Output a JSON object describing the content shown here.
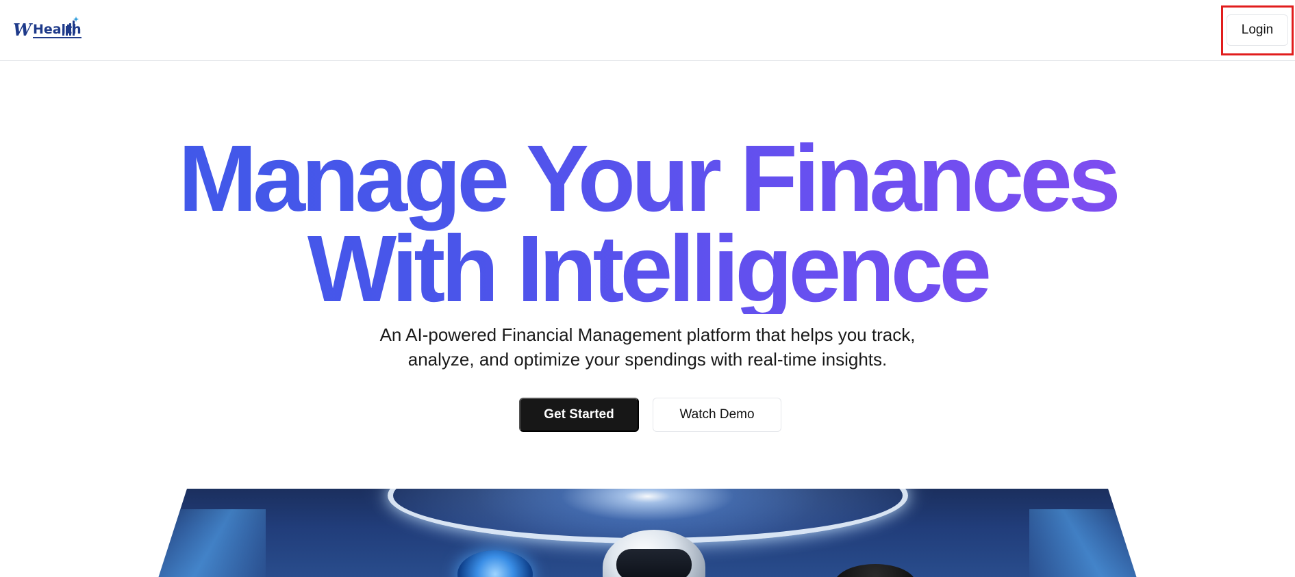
{
  "header": {
    "logo": {
      "mark": "W",
      "text": "Health",
      "icon": "bar-chart-growth-icon"
    },
    "login_label": "Login"
  },
  "hero": {
    "title_line1": "Manage Your Finances",
    "title_line2": "With Intelligence",
    "subtitle_line1": "An AI-powered Financial Management platform that helps you track,",
    "subtitle_line2": "analyze, and optimize your spendings with real-time insights.",
    "primary_cta": "Get Started",
    "secondary_cta": "Watch Demo"
  },
  "colors": {
    "title_gradient_start": "#3b5be8",
    "title_gradient_end": "#8b4cf1",
    "primary_button": "#171717",
    "highlight_box": "#e11d1d",
    "logo": "#1e3a8a"
  }
}
